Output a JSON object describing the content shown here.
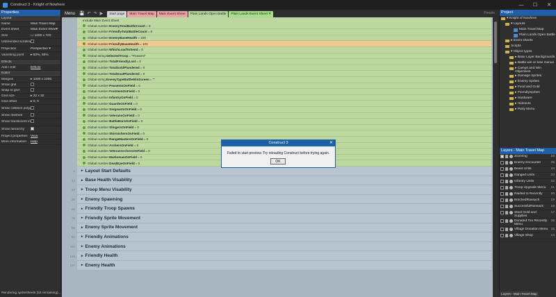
{
  "window": {
    "title": "Construct 3 - Knight of Nowhere",
    "controls": [
      "—",
      "☐",
      "✕"
    ]
  },
  "properties": {
    "title": "Properties",
    "rows": [
      {
        "k": "Layout",
        "v": "",
        "sec": true
      },
      {
        "k": "Name",
        "v": "Main Travel Map"
      },
      {
        "k": "Event sheet",
        "v": "Main Event Shee▾"
      },
      {
        "k": "Size",
        "v": "☐ 1280 x 720"
      },
      {
        "k": "Unbounded scrolling",
        "v": "chk",
        "tall": true
      },
      {
        "k": "Projection",
        "v": "Perspective ▾"
      },
      {
        "k": "Vanishing point",
        "v": "▸ 50%, 50%",
        "tall": true
      },
      {
        "k": "Effects",
        "v": "",
        "sec": true
      },
      {
        "k": "Add / edit",
        "v": "Effects",
        "link": true
      },
      {
        "k": "Editor",
        "v": "",
        "sec": true
      },
      {
        "k": "Margins",
        "v": "▸ 1000 x 1000"
      },
      {
        "k": "Show grid",
        "v": "chk"
      },
      {
        "k": "Snap to grid",
        "v": "chk"
      },
      {
        "k": "Grid size",
        "v": "▸ 32 x 32"
      },
      {
        "k": "Grid offset",
        "v": "▸ 0, 0"
      },
      {
        "k": "Show collision polygons",
        "v": "chk",
        "tall": true
      },
      {
        "k": "Show meshes",
        "v": "chk"
      },
      {
        "k": "Show translucent inactive layers",
        "v": "chk",
        "tall": true
      },
      {
        "k": "Show hierarchy",
        "v": "chkon",
        "tall": true
      },
      {
        "k": "Project properties",
        "v": "View",
        "link": true
      },
      {
        "k": "More information",
        "v": "Help",
        "link": true
      }
    ],
    "status": "Rendering spritesheets (52 remaining)..."
  },
  "toolbar": {
    "menu": "Menu",
    "icons": [
      "💾",
      "↶",
      "↷",
      "▶"
    ],
    "tabs": [
      {
        "label": "Start page",
        "color": "#d8d8d8"
      },
      {
        "label": "Main Travel Map",
        "color": "#e9a4a4"
      },
      {
        "label": "Main Event Sheet",
        "color": "#e9a4a4"
      },
      {
        "label": "Plain Lands Open Battle",
        "color": "#b8d7a0"
      },
      {
        "label": "Plain Lands Event Sheet ✕",
        "color": "#a7e08a"
      }
    ],
    "people": "People"
  },
  "events": {
    "include": "Include Main Event Sheet",
    "vars": [
      {
        "pre": "Global number",
        "name": "EnemyTotalBattleCount",
        "val": "= 0"
      },
      {
        "pre": "Global number",
        "name": "FriendlyTotalBattleCount",
        "val": "= 0"
      },
      {
        "pre": "Global number",
        "name": "EnemyBaseHealth",
        "val": "= 100"
      },
      {
        "pre": "Global number",
        "name": "FriendlyBaseHealth",
        "val": "= 100",
        "sel": true
      },
      {
        "pre": "Global number",
        "name": "WhichLoadToSend",
        "val": "= 0"
      },
      {
        "pre": "Global string",
        "name": "SelectedTroop",
        "val": "= \"Peasent\""
      },
      {
        "pre": "Global number",
        "name": "TotalFriendlyLost",
        "val": "= 0"
      },
      {
        "pre": "Global number",
        "name": "TotalGoldPlundered",
        "val": "= 0"
      },
      {
        "pre": "Global number",
        "name": "TotalGoatPlundered",
        "val": "= 0"
      },
      {
        "pre": "Global string",
        "name": "EnemyTypeBattleWinScreen",
        "val": "= \"\""
      },
      {
        "pre": "Global number",
        "name": "PeasentsOnField",
        "val": "= 0"
      },
      {
        "pre": "Global number",
        "name": "FootmenOnField",
        "val": "= 0"
      },
      {
        "pre": "Global number",
        "name": "InfantryOnField",
        "val": "= 0"
      },
      {
        "pre": "Global number",
        "name": "GuardsOnField",
        "val": "= 0"
      },
      {
        "pre": "Global number",
        "name": "SergeantsOnField",
        "val": "= 0"
      },
      {
        "pre": "Global number",
        "name": "VeteransOnField",
        "val": "= 0"
      },
      {
        "pre": "Global number",
        "name": "BattleBornOnField",
        "val": "= 0"
      },
      {
        "pre": "Global number",
        "name": "SlingersOnField",
        "val": "= 0"
      },
      {
        "pre": "Global number",
        "name": "SkirmishersOnField",
        "val": "= 0"
      },
      {
        "pre": "Global number",
        "name": "RangeMastersOnField",
        "val": "= 0"
      },
      {
        "pre": "Global number",
        "name": "ArchersOnField",
        "val": "= 0"
      },
      {
        "pre": "Global number",
        "name": "VeteranArchersOnField",
        "val": "= 0"
      },
      {
        "pre": "Global number",
        "name": "MarksmanOnField",
        "val": "= 0"
      },
      {
        "pre": "Global number",
        "name": "DeadEyeOnField",
        "val": "= 0"
      }
    ],
    "groups": [
      {
        "num": "1",
        "label": "Layout Start Defaults"
      },
      {
        "num": "13",
        "label": "Base Health Visability"
      },
      {
        "num": "17",
        "label": "Troop Menu Visability"
      },
      {
        "num": "36",
        "label": "Enemy Spawning"
      },
      {
        "num": "49",
        "label": "Friendly Troop Spawns"
      },
      {
        "num": "76",
        "label": "Friendly Sprite Movement"
      },
      {
        "num": "85",
        "label": "Enemy Sprite Movement"
      },
      {
        "num": "94",
        "label": "Friendly Animations"
      },
      {
        "num": "110",
        "label": "Enemy Animations"
      },
      {
        "num": "120",
        "label": "Friendly Health"
      },
      {
        "num": "127",
        "label": "Enemy Health"
      }
    ]
  },
  "project": {
    "title": "Project",
    "items": [
      {
        "label": "▾ Knight of Nowhere",
        "indent": 0,
        "icon": "folder-icon"
      },
      {
        "label": "▾ Layouts",
        "indent": 6,
        "icon": "folder-icon"
      },
      {
        "label": "Main Travel Map",
        "indent": 18,
        "icon": "layout-icon"
      },
      {
        "label": "Plain Lands Open Battle",
        "indent": 18,
        "icon": "layout-icon"
      },
      {
        "label": "▸ Event sheets",
        "indent": 6,
        "icon": "folder-icon"
      },
      {
        "label": "Scripts",
        "indent": 6,
        "icon": "folder-icon"
      },
      {
        "label": "▾ Object types",
        "indent": 6,
        "icon": "folder-icon"
      },
      {
        "label": "▸ Base Layer Backgrounds",
        "indent": 12,
        "icon": "folder-icon"
      },
      {
        "label": "▸ Battle win or lose menus",
        "indent": 12,
        "icon": "folder-icon"
      },
      {
        "label": "▸ Camps and Win Objectives",
        "indent": 12,
        "icon": "folder-icon"
      },
      {
        "label": "▸ Damage Sprites",
        "indent": 12,
        "icon": "folder-icon"
      },
      {
        "label": "▸ Enemy Sprites",
        "indent": 12,
        "icon": "folder-icon"
      },
      {
        "label": "▸ Food and Gold",
        "indent": 12,
        "icon": "folder-icon"
      },
      {
        "label": "▸ FriendlySprites",
        "indent": 12,
        "icon": "folder-icon"
      },
      {
        "label": "▸ Hardware",
        "indent": 12,
        "icon": "folder-icon"
      },
      {
        "label": "▸ Hideouts",
        "indent": 12,
        "icon": "folder-icon"
      },
      {
        "label": "▸ Party Menu",
        "indent": 12,
        "icon": "folder-icon"
      }
    ]
  },
  "layers": {
    "title": "Layers - Main Travel Map",
    "rows": [
      {
        "name": "Zooming",
        "num": "26",
        "on": true
      },
      {
        "name": "Enemy Encounter",
        "num": "25"
      },
      {
        "name": "Beast Units",
        "num": "24"
      },
      {
        "name": "Ranged Units",
        "num": "23"
      },
      {
        "name": "Infantry Units",
        "num": "22"
      },
      {
        "name": "Troop Upgrade Menu",
        "num": "21"
      },
      {
        "name": "Raided to Recently",
        "num": "20"
      },
      {
        "name": "BotchedRansack",
        "num": "19"
      },
      {
        "name": "SuccessfulRansack",
        "num": "18"
      },
      {
        "name": "Steel Gold and Supplies",
        "num": "17"
      },
      {
        "name": "Donated Too Recently Menu",
        "num": "16"
      },
      {
        "name": "Village Donation Menu",
        "num": "15"
      },
      {
        "name": "Village Shop",
        "num": "14"
      }
    ],
    "bottom_tab": "Layers - Main Travel Map"
  },
  "dialog": {
    "title": "Construct 3",
    "message": "Failed to start preview. Try reloading Construct before trying again.",
    "ok": "OK",
    "close": "✕"
  }
}
